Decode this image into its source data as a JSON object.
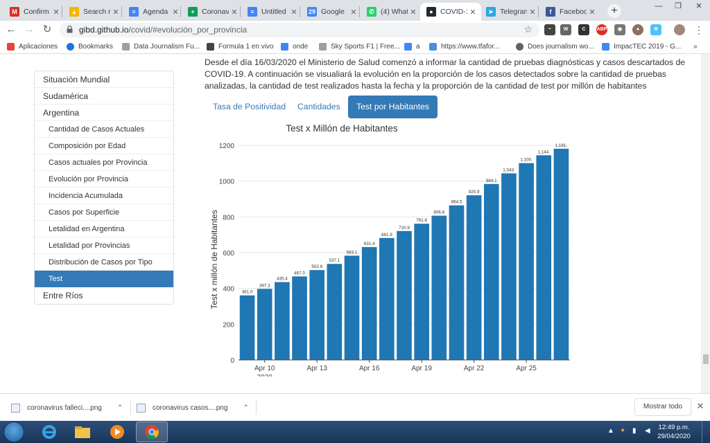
{
  "browser": {
    "tabs": [
      {
        "title": "Confirm",
        "icon": "gmail-icon",
        "color": "#d93025",
        "glyph": "M"
      },
      {
        "title": "Search r",
        "icon": "google-drive-icon",
        "color": "#f4b400",
        "glyph": "▲"
      },
      {
        "title": "Agenda",
        "icon": "google-docs-icon",
        "color": "#4285f4",
        "glyph": "≡"
      },
      {
        "title": "Coronav",
        "icon": "google-sheets-icon",
        "color": "#0f9d58",
        "glyph": "+"
      },
      {
        "title": "Untitled",
        "icon": "google-docs-icon",
        "color": "#4285f4",
        "glyph": "≡"
      },
      {
        "title": "Google",
        "icon": "google-calendar-icon",
        "color": "#4285f4",
        "glyph": "29"
      },
      {
        "title": "(4) What",
        "icon": "whatsapp-icon",
        "color": "#25d366",
        "glyph": "✆"
      },
      {
        "title": "COVID-1",
        "icon": "github-icon",
        "color": "#24292e",
        "glyph": "●"
      },
      {
        "title": "Telegran",
        "icon": "telegram-icon",
        "color": "#2ca5e0",
        "glyph": "➤"
      },
      {
        "title": "Faceboo",
        "icon": "facebook-icon",
        "color": "#3b5998",
        "glyph": "f"
      }
    ],
    "active_tab_index": 7,
    "url_host": "gibd.github.io",
    "url_path": "/covid/#evolución_por_provincia",
    "bookmarks": [
      {
        "label": "Aplicaciones",
        "icon": "apps-grid-icon"
      },
      {
        "label": "Bookmarks",
        "icon": "star-icon"
      },
      {
        "label": "Data Journalism Fu...",
        "icon": "page-icon"
      },
      {
        "label": "Formula 1 en vivo",
        "icon": "car-icon"
      },
      {
        "label": "onde",
        "icon": "google-docs-icon"
      },
      {
        "label": "Sky Sports F1 | Free...",
        "icon": "page-icon"
      },
      {
        "label": "a",
        "icon": "google-docs-icon"
      },
      {
        "label": "https://www.tfafor...",
        "icon": "diamond-icon"
      },
      {
        "label": "Does journalism wo...",
        "icon": "globe-icon"
      },
      {
        "label": "ImpacTEC 2019 - G...",
        "icon": "google-docs-icon"
      }
    ],
    "bookmarks_more": "»"
  },
  "page": {
    "intro": "Desde el día 16/03/2020 el Ministerio de Salud comenzó a informar la cantidad de pruebas diagnósticas y casos descartados de COVID-19. A continuación se visualiará la evolución en la proporción de los casos detectados sobre la cantidad de pruebas analizadas, la cantidad de test realizados hasta la fecha y la proporción de la cantidad de test por millón de habitantes",
    "nav": [
      {
        "label": "Situación Mundial",
        "level": 0
      },
      {
        "label": "Sudamérica",
        "level": 0
      },
      {
        "label": "Argentina",
        "level": 0
      },
      {
        "label": "Cantidad de Casos Actuales",
        "level": 1
      },
      {
        "label": "Composición por Edad",
        "level": 1
      },
      {
        "label": "Casos actuales por Provincia",
        "level": 1
      },
      {
        "label": "Evolución por Provincia",
        "level": 1
      },
      {
        "label": "Incidencia Acumulada",
        "level": 1
      },
      {
        "label": "Casos por Superficie",
        "level": 1
      },
      {
        "label": "Letalidad en Argentina",
        "level": 1
      },
      {
        "label": "Letalidad por Provincias",
        "level": 1
      },
      {
        "label": "Distribución de Casos por Tipo",
        "level": 1
      },
      {
        "label": "Test",
        "level": 1,
        "active": true
      },
      {
        "label": "Entre Ríos",
        "level": 0
      }
    ],
    "tabs": [
      "Tasa de Positividad",
      "Cantidades",
      "Test por Habitantes"
    ],
    "active_tab": 2
  },
  "chart_data": {
    "type": "bar",
    "title": "Test x Millón de Habitantes",
    "xlabel": "",
    "ylabel": "Test x millón de Habitantes",
    "ylim": [
      0,
      1200
    ],
    "yticks": [
      0,
      200,
      400,
      600,
      800,
      1000,
      1200
    ],
    "xticks": [
      {
        "label": "Apr 10",
        "sublabel": "2020",
        "index": 1
      },
      {
        "label": "Apr 13",
        "index": 4
      },
      {
        "label": "Apr 16",
        "index": 7
      },
      {
        "label": "Apr 19",
        "index": 10
      },
      {
        "label": "Apr 22",
        "index": 13
      },
      {
        "label": "Apr 25",
        "index": 16
      }
    ],
    "categories": [
      "Apr 9",
      "Apr 10",
      "Apr 11",
      "Apr 12",
      "Apr 13",
      "Apr 14",
      "Apr 15",
      "Apr 16",
      "Apr 17",
      "Apr 18",
      "Apr 19",
      "Apr 20",
      "Apr 21",
      "Apr 22",
      "Apr 23",
      "Apr 24",
      "Apr 25",
      "Apr 26",
      "Apr 27"
    ],
    "values": [
      361.0,
      397.3,
      435.4,
      467.0,
      502.6,
      537.1,
      583.1,
      631.4,
      681.9,
      720.9,
      761.8,
      806.8,
      864.5,
      920.9,
      984.1,
      1043.5,
      1100.7,
      1144.6,
      1181.2
    ],
    "value_labels": [
      "361.0",
      "397.3",
      "435.4",
      "467.0",
      "502.6",
      "537.1",
      "583.1",
      "631.4",
      "681.9",
      "720.9",
      "761.8",
      "806.8",
      "864.5",
      "920.9",
      "984.1",
      "1,043.",
      "1,100.",
      "1,144.",
      "1,181."
    ],
    "bar_color": "#1f77b4",
    "grid": true
  },
  "downloads": [
    {
      "name": "coronavirus falleci....png",
      "icon": "image-file-icon"
    },
    {
      "name": "coronavirus casos....png",
      "icon": "image-file-icon"
    }
  ],
  "downloads_show_all": "Mostrar todo",
  "taskbar": {
    "time": "12:49 p.m.",
    "date": "29/04/2020"
  }
}
